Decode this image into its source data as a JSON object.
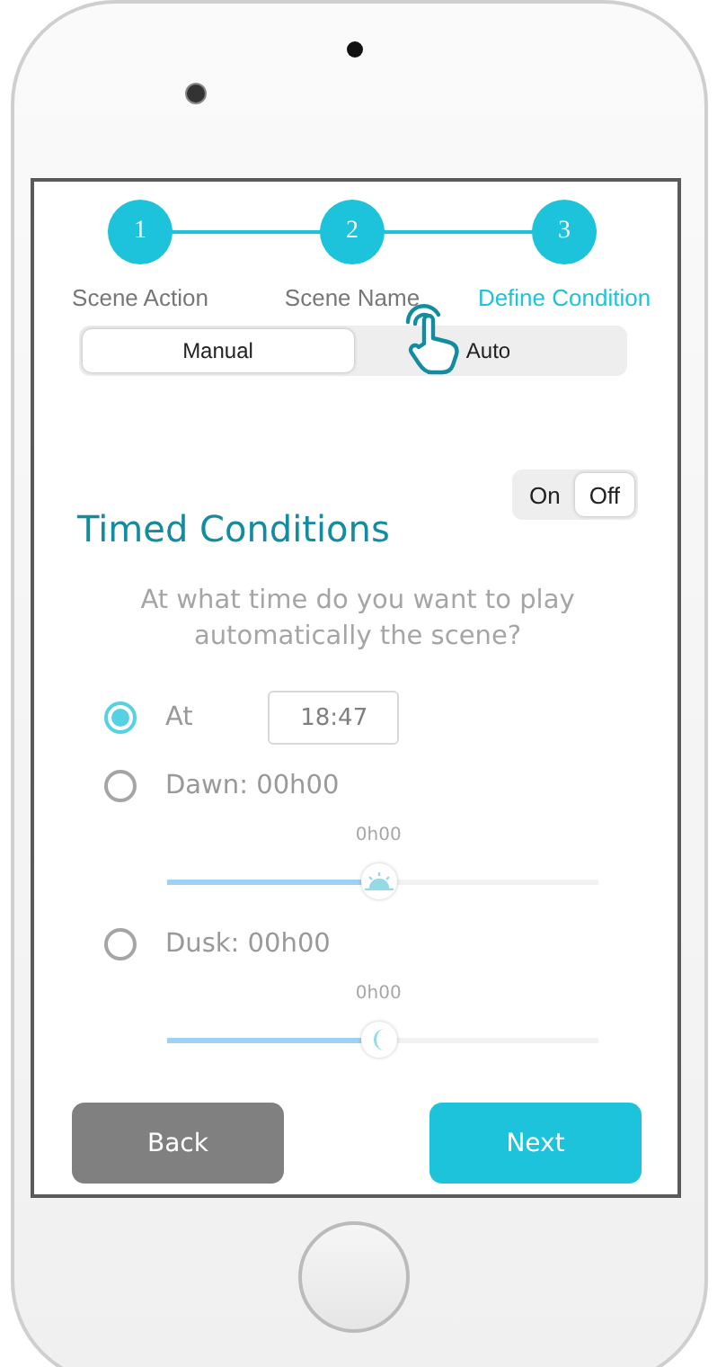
{
  "steps": [
    {
      "number": "1",
      "label": "Scene Action",
      "selected": false
    },
    {
      "number": "2",
      "label": "Scene Name",
      "selected": false
    },
    {
      "number": "3",
      "label": "Define Condition",
      "selected": true
    }
  ],
  "mode_tabs": [
    {
      "label": "Manual",
      "selected": true
    },
    {
      "label": "Auto",
      "selected": false
    }
  ],
  "timed_conditions": {
    "title": "Timed Conditions",
    "toggle": [
      {
        "label": "On",
        "selected": false
      },
      {
        "label": "Off",
        "selected": true
      }
    ],
    "question": "At what time do you want to play automatically the scene?",
    "options": [
      {
        "kind": "time",
        "label": "At",
        "selected": true,
        "value": "18:47"
      },
      {
        "kind": "sunrise",
        "label": "Dawn: 00h00",
        "selected": false,
        "reading": "0h00",
        "level": 0.49
      },
      {
        "kind": "sunset",
        "label": "Dusk: 00h00",
        "selected": false,
        "reading": "0h00",
        "level": 0.49
      }
    ]
  },
  "buttons": [
    {
      "kind": "back",
      "label": "Back"
    },
    {
      "kind": "next",
      "label": "Next"
    }
  ]
}
